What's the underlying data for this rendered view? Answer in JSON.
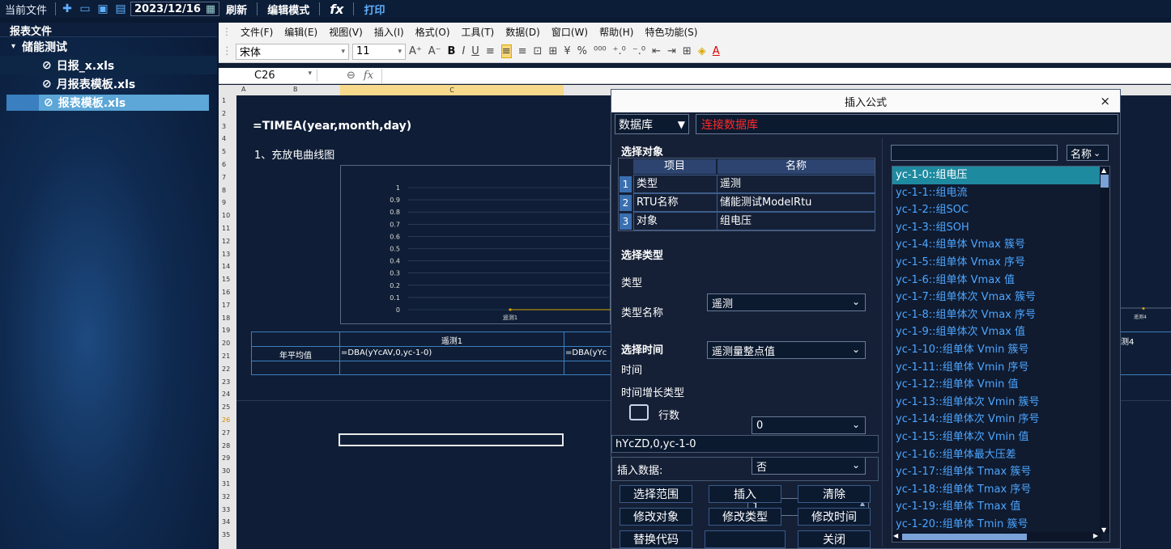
{
  "topbar": {
    "current_file": "当前文件",
    "date": "2023/12/16",
    "refresh": "刷新",
    "edit_mode": "编辑模式",
    "fx": "fx",
    "print": "打印"
  },
  "sidebar": {
    "header": "报表文件",
    "folder": "储能测试",
    "files": [
      "日报_x.xls",
      "月报表模板.xls",
      "报表模板.xls"
    ]
  },
  "menu": [
    "文件(F)",
    "编辑(E)",
    "视图(V)",
    "插入(I)",
    "格式(O)",
    "工具(T)",
    "数据(D)",
    "窗口(W)",
    "帮助(H)",
    "特色功能(S)"
  ],
  "format": {
    "font": "宋体",
    "size": "11"
  },
  "cellref": "C26",
  "columns": [
    "A",
    "B",
    "C"
  ],
  "rows": [
    "1",
    "2",
    "3",
    "4",
    "5",
    "6",
    "7",
    "8",
    "9",
    "10",
    "11",
    "12",
    "13",
    "14",
    "15",
    "16",
    "17",
    "18",
    "19",
    "20",
    "21",
    "22",
    "23",
    "24",
    "25",
    "26",
    "27",
    "28",
    "29",
    "30",
    "31",
    "32",
    "33",
    "34",
    "35"
  ],
  "sheet": {
    "formula1": "=TIMEA(year,month,day)",
    "section_title": "1、充放电曲线图",
    "row_label": "年平均值",
    "col1": "遥测1",
    "col_last": "测4",
    "f1": "=DBA(yYcAV,0,yc-1-0)",
    "f2": "=DBA(yYc"
  },
  "chart_data": {
    "type": "line",
    "categories": [
      "遥测1",
      "遥测4"
    ],
    "series": [
      {
        "values": [
          0,
          0
        ]
      }
    ],
    "ylim": [
      0,
      1
    ],
    "yticks": [
      "1",
      "0.9",
      "0.8",
      "0.7",
      "0.6",
      "0.5",
      "0.4",
      "0.3",
      "0.2",
      "0.1",
      "0"
    ]
  },
  "dialog": {
    "title": "插入公式",
    "close": "×",
    "db_label": "数据库",
    "connect": "连接数据库",
    "select_object": "选择对象",
    "obj_head": [
      "项目",
      "名称"
    ],
    "obj_rows": [
      [
        "1",
        "类型",
        "遥测"
      ],
      [
        "2",
        "RTU名称",
        "储能测试ModelRtu"
      ],
      [
        "3",
        "对象",
        "组电压"
      ]
    ],
    "select_type": "选择类型",
    "type_label": "类型",
    "type_value": "遥测",
    "typename_label": "类型名称",
    "typename_value": "遥测量整点值",
    "select_time": "选择时间",
    "time_label": "时间",
    "time_value": "0",
    "inc_label": "时间增长类型",
    "inc_value": "否",
    "rows_label": "行数",
    "rows_value": "1",
    "code": "hYcZD,0,yc-1-0",
    "insert_data": "插入数据:",
    "buttons": [
      "选择范围",
      "插入",
      "清除",
      "修改对象",
      "修改类型",
      "修改时间",
      "替换代码",
      "",
      "关闭"
    ],
    "sort_label": "名称",
    "list": [
      "yc-1-0::组电压",
      "yc-1-1::组电流",
      "yc-1-2::组SOC",
      "yc-1-3::组SOH",
      "yc-1-4::组单体 Vmax 簇号",
      "yc-1-5::组单体 Vmax 序号",
      "yc-1-6::组单体 Vmax 值",
      "yc-1-7::组单体次 Vmax 簇号",
      "yc-1-8::组单体次 Vmax 序号",
      "yc-1-9::组单体次 Vmax 值",
      "yc-1-10::组单体 Vmin 簇号",
      "yc-1-11::组单体 Vmin 序号",
      "yc-1-12::组单体 Vmin 值",
      "yc-1-13::组单体次 Vmin 簇号",
      "yc-1-14::组单体次 Vmin 序号",
      "yc-1-15::组单体次 Vmin 值",
      "yc-1-16::组单体最大压差",
      "yc-1-17::组单体 Tmax 簇号",
      "yc-1-18::组单体 Tmax 序号",
      "yc-1-19::组单体 Tmax 值",
      "yc-1-20::组单体 Tmin 簇号"
    ]
  }
}
